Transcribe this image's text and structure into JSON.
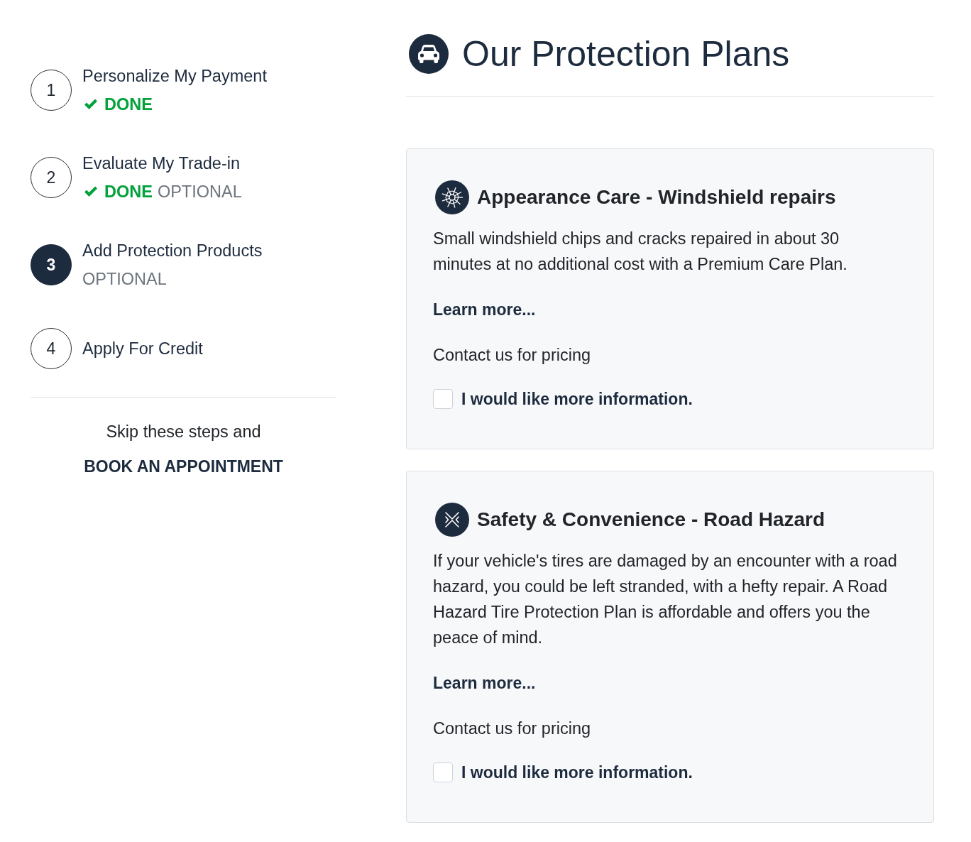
{
  "steps": [
    {
      "number": "1",
      "title": "Personalize My Payment",
      "selected": false,
      "status": [
        {
          "kind": "done",
          "text": "DONE"
        }
      ]
    },
    {
      "number": "2",
      "title": "Evaluate My Trade-in",
      "selected": false,
      "status": [
        {
          "kind": "done",
          "text": "DONE"
        },
        {
          "kind": "optional",
          "text": "OPTIONAL"
        }
      ]
    },
    {
      "number": "3",
      "title": "Add Protection Products",
      "selected": true,
      "status": [
        {
          "kind": "optional",
          "text": "OPTIONAL"
        }
      ]
    },
    {
      "number": "4",
      "title": "Apply For Credit",
      "selected": false
    }
  ],
  "skip": {
    "text": "Skip these steps and",
    "link": "BOOK AN APPOINTMENT"
  },
  "header": {
    "title": "Our Protection Plans"
  },
  "plans": [
    {
      "kind": "glass",
      "title": "Appearance Care - Windshield repairs",
      "description": "Small windshield chips and cracks repaired in about 30 minutes at no additional cost with a Premium Care Plan.",
      "link": "Learn more...",
      "pricing": "Contact us for pricing",
      "checkbox": {
        "label": "I would like more information.",
        "checked": false
      }
    },
    {
      "kind": "hazard",
      "title": "Safety & Convenience - Road Hazard",
      "description": "If your vehicle's tires are damaged by an encounter with a road hazard, you could be left stranded, with a hefty repair. A Road Hazard Tire Protection Plan is affordable and offers you the peace of mind.",
      "link": "Learn more...",
      "pricing": "Contact us for pricing",
      "checkbox": {
        "label": "I would like more information.",
        "checked": false
      }
    }
  ]
}
